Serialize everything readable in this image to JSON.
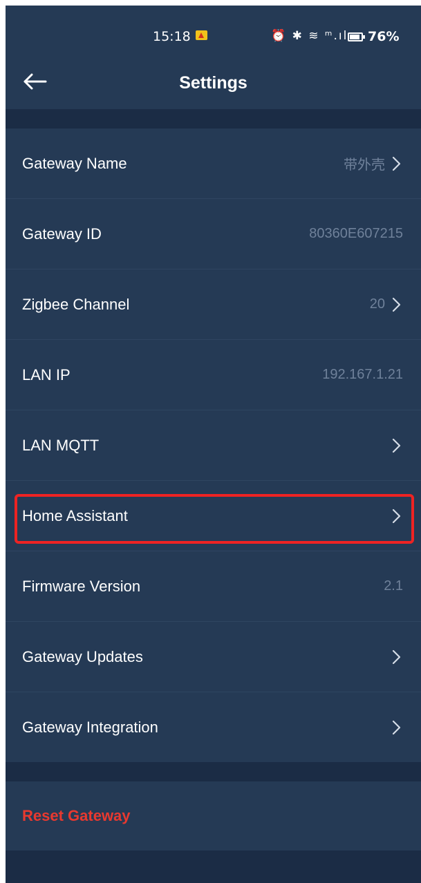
{
  "status_bar": {
    "time": "15:18",
    "icons": "⏰ ✱ ≋ ᵐ.ıl",
    "battery": "76%"
  },
  "header": {
    "title": "Settings",
    "back_icon": "arrow-left-icon"
  },
  "settings": [
    {
      "label": "Gateway Name",
      "value": "带外壳",
      "chevron": true
    },
    {
      "label": "Gateway ID",
      "value": "80360E607215",
      "chevron": false
    },
    {
      "label": "Zigbee Channel",
      "value": "20",
      "chevron": true
    },
    {
      "label": "LAN IP",
      "value": "192.167.1.21",
      "chevron": false
    },
    {
      "label": "LAN MQTT",
      "value": "",
      "chevron": true
    },
    {
      "label": "Home Assistant",
      "value": "",
      "chevron": true,
      "highlighted": true
    },
    {
      "label": "Firmware Version",
      "value": "2.1",
      "chevron": false
    },
    {
      "label": "Gateway Updates",
      "value": "",
      "chevron": true
    },
    {
      "label": "Gateway Integration",
      "value": "",
      "chevron": true
    }
  ],
  "reset": {
    "label": "Reset Gateway"
  },
  "colors": {
    "background": "#253a55",
    "section_gap": "#1b2c45",
    "danger": "#e8392f",
    "highlight_border": "#ee2323"
  }
}
